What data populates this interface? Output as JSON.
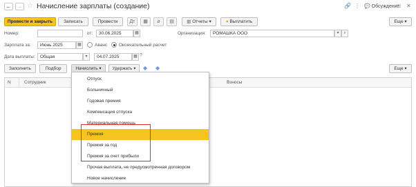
{
  "window": {
    "title": "Начисление зарплаты (создание)",
    "discussion_label": "Обсуждение",
    "nav_back": "←",
    "nav_forward": "→",
    "star": "☆",
    "link_icon": "🔗",
    "more_icon": "⋮",
    "max_icon": "□",
    "close_icon": "✕"
  },
  "toolbar": {
    "post_close": "Провести и закрыть",
    "save": "Записать",
    "post": "Провести",
    "reports": "Отчеты",
    "pay": "Выплатить",
    "more": "Еще"
  },
  "header_form": {
    "number_label": "Номер:",
    "number_value": "",
    "from_label": "от:",
    "date_value": "30.06.2025",
    "org_label": "Организация:",
    "org_value": "РОМАШКА ООО",
    "salary_for_label": "Зарплата за:",
    "month_value": "Июнь 2025",
    "advance_label": "Аванс",
    "final_label": "Окончательный расчет",
    "pay_date_label": "Дата выплаты:",
    "pay_type_value": "Общая",
    "pay_date_value": "04.07.2025",
    "help": "?"
  },
  "table_toolbar": {
    "fill": "Заполнить",
    "select": "Подбор",
    "accrue": "Начислить",
    "withhold": "Удержать",
    "more": "Еще"
  },
  "grid": {
    "columns": [
      "N",
      "Сотрудник",
      "Взносы"
    ]
  },
  "accrue_menu": {
    "items": [
      "Отпуск",
      "Больничный",
      "Годовая премия",
      "Компенсация отпуска",
      "Материальная помощь",
      "Премия",
      "Премия за год",
      "Премия за счет прибыли",
      "Прочая выплата, не предусмотренная договором",
      "Новое начисление"
    ],
    "selected": "Премия"
  },
  "colors": {
    "accent_yellow": "#f6c320",
    "highlight_red": "#d9302c"
  }
}
